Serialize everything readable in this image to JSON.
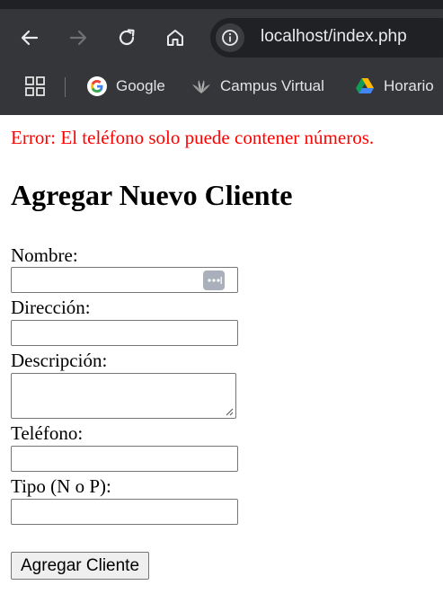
{
  "browser": {
    "url": "localhost/index.php",
    "nav": {
      "back_icon": "arrow-left-icon",
      "forward_icon": "arrow-right-icon",
      "reload_icon": "reload-icon",
      "home_icon": "home-icon",
      "site_info_icon": "info-icon"
    },
    "bookmarks": [
      {
        "label": "Google",
        "icon": "google-g-icon"
      },
      {
        "label": "Campus Virtual",
        "icon": "campus-leaf-icon"
      },
      {
        "label": "Horario",
        "icon": "google-drive-icon"
      }
    ],
    "colors": {
      "chrome_bg": "#35363a",
      "omnibox_bg": "#202124",
      "text": "#e8eaed"
    }
  },
  "page": {
    "error": "Error: El teléfono solo puede contener números.",
    "error_color": "#ff0000",
    "title": "Agregar Nuevo Cliente",
    "form": {
      "fields": [
        {
          "label": "Nombre:",
          "value": ""
        },
        {
          "label": "Dirección:",
          "value": ""
        },
        {
          "label": "Descripción:",
          "value": ""
        },
        {
          "label": "Teléfono:",
          "value": ""
        },
        {
          "label": "Tipo (N o P):",
          "value": ""
        }
      ],
      "submit_label": "Agregar Cliente"
    }
  }
}
